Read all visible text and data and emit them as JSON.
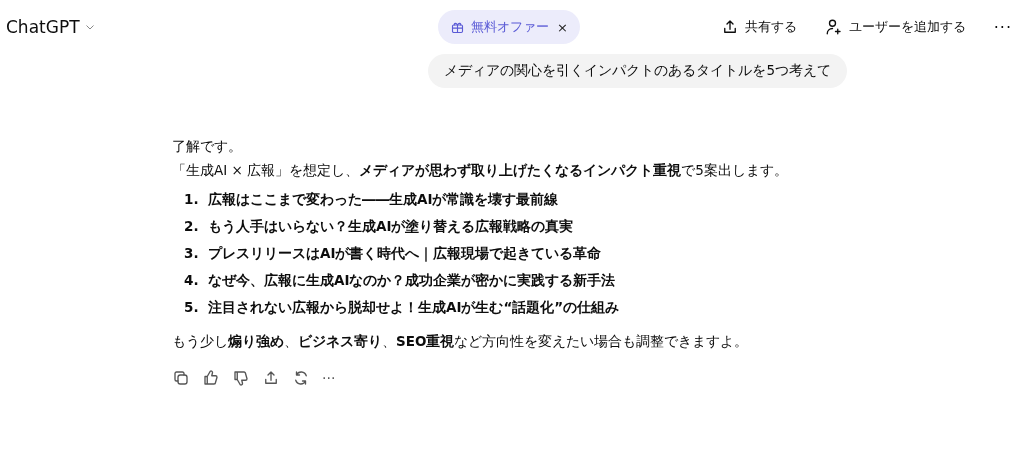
{
  "header": {
    "model": "ChatGPT",
    "promo": {
      "label": "無料オファー",
      "close": "×"
    },
    "share": "共有する",
    "add_user": "ユーザーを追加する",
    "more": "···"
  },
  "user_message": "メディアの関心を引くインパクトのあるタイトルを5つ考えて",
  "response": {
    "intro": [
      "了解です。",
      "「生成AI × 広報」を想定し、**メディアが思わず取り上げたくなるインパクト重視**で5案出します。"
    ],
    "titles": [
      {
        "number": "1.",
        "text": "広報はここまで変わった――生成AIが常識を壊す最前線"
      },
      {
        "number": "2.",
        "text": "もう人手はいらない？生成AIが塗り替える広報戦略の真実"
      },
      {
        "number": "3.",
        "text": "プレスリリースはAIが書く時代へ｜広報現場で起きている革命"
      },
      {
        "number": "4.",
        "text": "なぜ今、広報に生成AIなのか？成功企業が密かに実践する新手法"
      },
      {
        "number": "5.",
        "text": "注目されない広報から脱却せよ！生成AIが生む“話題化”の仕組み"
      }
    ],
    "outro": "もう少し**煽り強め**、**ビジネス寄り**、**SEO重視**など方向性を変えたい場合も調整できますよ。",
    "actions": [
      {
        "kind": "copy"
      },
      {
        "kind": "like"
      },
      {
        "kind": "dislike"
      },
      {
        "kind": "share"
      },
      {
        "kind": "regenerate"
      },
      {
        "kind": "more",
        "label": "···"
      }
    ]
  }
}
